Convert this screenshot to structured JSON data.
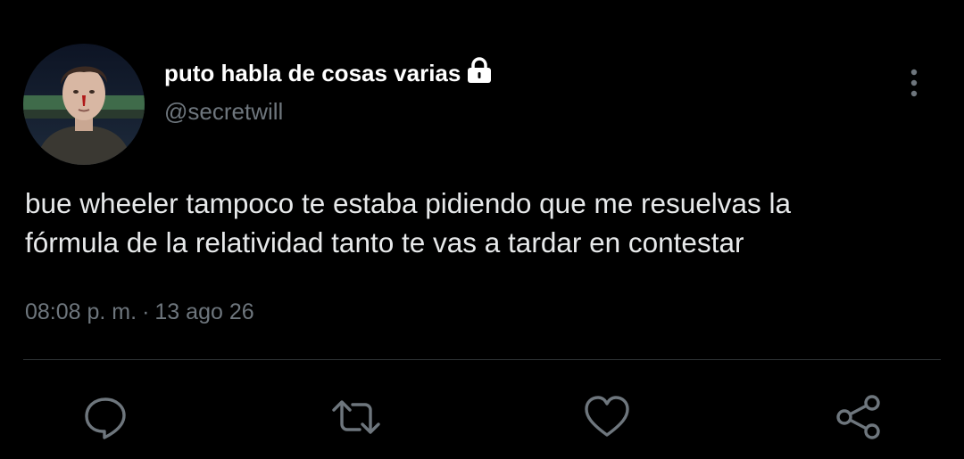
{
  "tweet": {
    "author": {
      "display_name": "puto habla de cosas varias",
      "handle": "@secretwill",
      "protected": true
    },
    "text_lines": [
      "bue wheeler tampoco te estaba pidiendo que me resuelvas la",
      "fórmula de la relatividad tanto te vas a tardar en contestar"
    ],
    "time": "08:08 p. m.",
    "separator": "·",
    "date": "13 ago 26"
  },
  "icons": {
    "lock": "lock-icon",
    "more": "more-vertical-icon",
    "reply": "reply-icon",
    "retweet": "retweet-icon",
    "like": "heart-icon",
    "share": "share-icon"
  },
  "colors": {
    "background": "#000000",
    "text_primary": "#e7e9ea",
    "text_secondary": "#6e767d",
    "divider": "#2f3336",
    "icon": "#6e767d"
  }
}
